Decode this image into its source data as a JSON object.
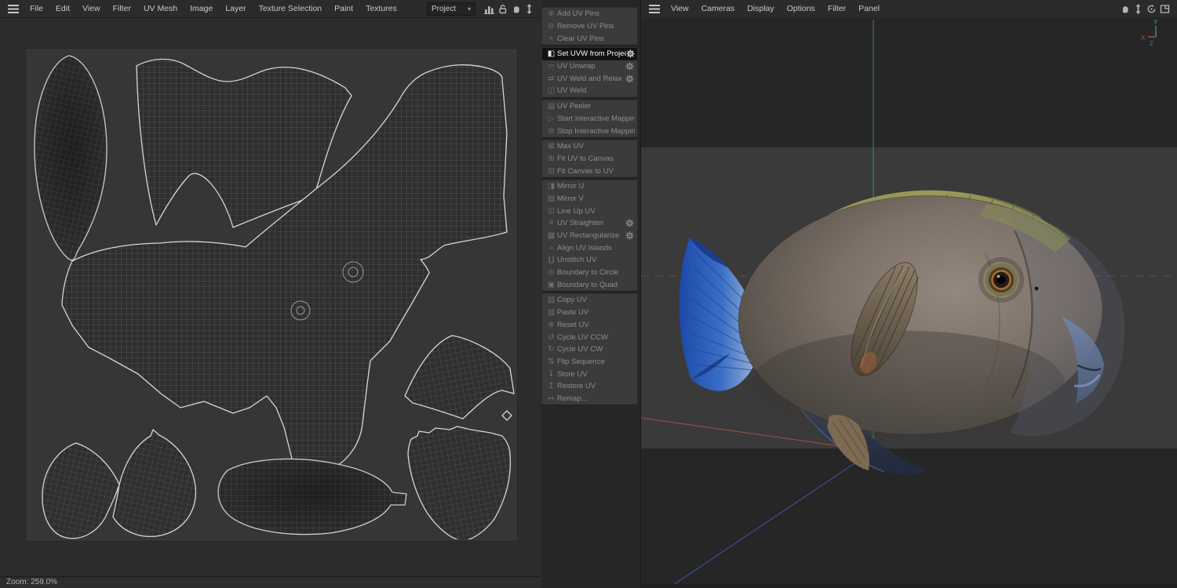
{
  "left_panel": {
    "menubar": [
      "File",
      "Edit",
      "View",
      "Filter",
      "UV Mesh",
      "Image",
      "Layer",
      "Texture Selection",
      "Paint",
      "Textures"
    ],
    "project_dropdown": "Project",
    "toolbar_icons": [
      "histogram-icon",
      "unlock-icon",
      "hand-icon",
      "double-arrow-vertical-icon"
    ],
    "statusbar": {
      "zoom": "Zoom: 259.0%"
    }
  },
  "uv_menu": {
    "groups": [
      {
        "items": [
          {
            "label": "Add UV Pins",
            "icon": "pin-add"
          },
          {
            "label": "Remove UV Pins",
            "icon": "pin-remove"
          },
          {
            "label": "Clear UV Pins",
            "icon": "clear"
          }
        ]
      },
      {
        "items": [
          {
            "label": "Set UVW from Projection",
            "icon": "split-square",
            "gear": true,
            "state": "selected"
          },
          {
            "label": "UV Unwrap",
            "icon": "unwrap",
            "gear": true
          },
          {
            "label": "UV Weld and Relax",
            "icon": "weld-relax",
            "gear": true
          },
          {
            "label": "UV Weld",
            "icon": "weld"
          }
        ]
      },
      {
        "items": [
          {
            "label": "UV Peeler",
            "icon": "peeler"
          },
          {
            "label": "Start Interactive Mapping",
            "icon": "play"
          },
          {
            "label": "Stop Interactive Mapping",
            "icon": "stop"
          }
        ]
      },
      {
        "items": [
          {
            "label": "Max UV",
            "icon": "max"
          },
          {
            "label": "Fit UV to Canvas",
            "icon": "fit-in"
          },
          {
            "label": "Fit Canvas to UV",
            "icon": "fit-out"
          }
        ]
      },
      {
        "items": [
          {
            "label": "Mirror U",
            "icon": "mirror-u"
          },
          {
            "label": "Mirror V",
            "icon": "mirror-v"
          },
          {
            "label": "Line Up UV",
            "icon": "line-up"
          },
          {
            "label": "UV Straighten",
            "icon": "straighten",
            "gear": true
          },
          {
            "label": "UV Rectangularize",
            "icon": "rectangularize",
            "gear": true
          },
          {
            "label": "Align UV Islands",
            "icon": "align"
          },
          {
            "label": "Unstitch UV",
            "icon": "unstitch"
          },
          {
            "label": "Boundary to Circle",
            "icon": "boundary-circle"
          },
          {
            "label": "Boundary to Quad",
            "icon": "boundary-quad"
          }
        ]
      },
      {
        "items": [
          {
            "label": "Copy UV",
            "icon": "copy"
          },
          {
            "label": "Paste UV",
            "icon": "paste"
          },
          {
            "label": "Reset UV",
            "icon": "reset"
          },
          {
            "label": "Cycle UV CCW",
            "icon": "cycle-ccw"
          },
          {
            "label": "Cycle UV CW",
            "icon": "cycle-cw"
          },
          {
            "label": "Flip Sequence",
            "icon": "flip"
          },
          {
            "label": "Store UV",
            "icon": "store"
          },
          {
            "label": "Restore UV",
            "icon": "restore"
          },
          {
            "label": "Remap...",
            "icon": "remap"
          }
        ]
      }
    ]
  },
  "viewport": {
    "menubar": [
      "View",
      "Cameras",
      "Display",
      "Options",
      "Filter",
      "Panel"
    ],
    "corner_icons": [
      "hand-icon",
      "pan-vertical-icon",
      "rotate-icon",
      "maximize-panel-icon"
    ],
    "gizmo": {
      "x": "X",
      "y": "Y",
      "z": "Z"
    },
    "colors": {
      "axis_x": "#b05047",
      "axis_y": "#39a15b",
      "axis_z": "#4a69c8",
      "workplane_dash": "#7a5a58",
      "render_band": "#3a3a3a",
      "background": "#262626",
      "fish_body": "#7d7168",
      "fish_dorsal": "#8f8f54",
      "fish_tail": "#2a62c8",
      "fish_eye_ring": "#ad6e2e",
      "fish_snout": "#7287ac"
    }
  }
}
